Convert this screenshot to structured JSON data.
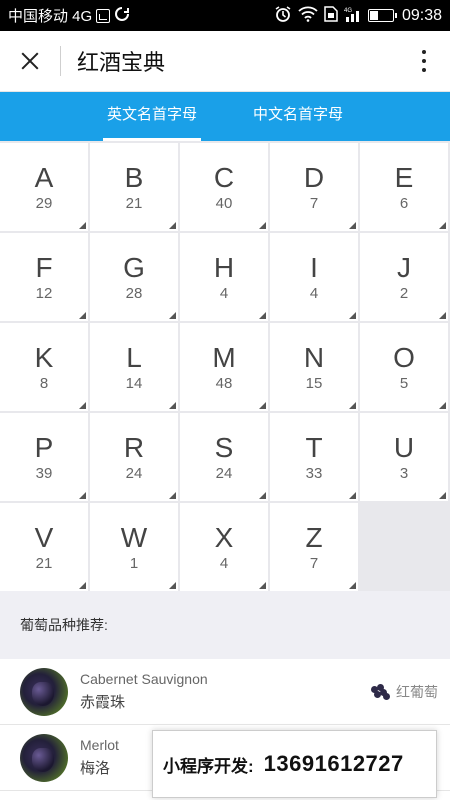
{
  "status_bar": {
    "carrier": "中国移动 4G",
    "network": "4G",
    "time": "09:38",
    "battery_level": 0.35
  },
  "title_bar": {
    "title": "红酒宝典"
  },
  "tabs": [
    {
      "label": "英文名首字母",
      "active": true
    },
    {
      "label": "中文名首字母",
      "active": false
    }
  ],
  "letters": [
    {
      "letter": "A",
      "count": "29"
    },
    {
      "letter": "B",
      "count": "21"
    },
    {
      "letter": "C",
      "count": "40"
    },
    {
      "letter": "D",
      "count": "7"
    },
    {
      "letter": "E",
      "count": "6"
    },
    {
      "letter": "F",
      "count": "12"
    },
    {
      "letter": "G",
      "count": "28"
    },
    {
      "letter": "H",
      "count": "4"
    },
    {
      "letter": "I",
      "count": "4"
    },
    {
      "letter": "J",
      "count": "2"
    },
    {
      "letter": "K",
      "count": "8"
    },
    {
      "letter": "L",
      "count": "14"
    },
    {
      "letter": "M",
      "count": "48"
    },
    {
      "letter": "N",
      "count": "15"
    },
    {
      "letter": "O",
      "count": "5"
    },
    {
      "letter": "P",
      "count": "39"
    },
    {
      "letter": "R",
      "count": "24"
    },
    {
      "letter": "S",
      "count": "24"
    },
    {
      "letter": "T",
      "count": "33"
    },
    {
      "letter": "U",
      "count": "3"
    },
    {
      "letter": "V",
      "count": "21"
    },
    {
      "letter": "W",
      "count": "1"
    },
    {
      "letter": "X",
      "count": "4"
    },
    {
      "letter": "Z",
      "count": "7"
    }
  ],
  "recommend": {
    "title": "葡萄品种推荐:",
    "items": [
      {
        "name": "Cabernet Sauvignon",
        "cn": "赤霞珠",
        "tag": "红葡萄",
        "tag_icon": "grape-icon"
      },
      {
        "name": "Merlot",
        "cn": "梅洛",
        "tag": "",
        "tag_icon": ""
      }
    ]
  },
  "promo": {
    "label": "小程序开发:",
    "phone": "13691612727"
  }
}
